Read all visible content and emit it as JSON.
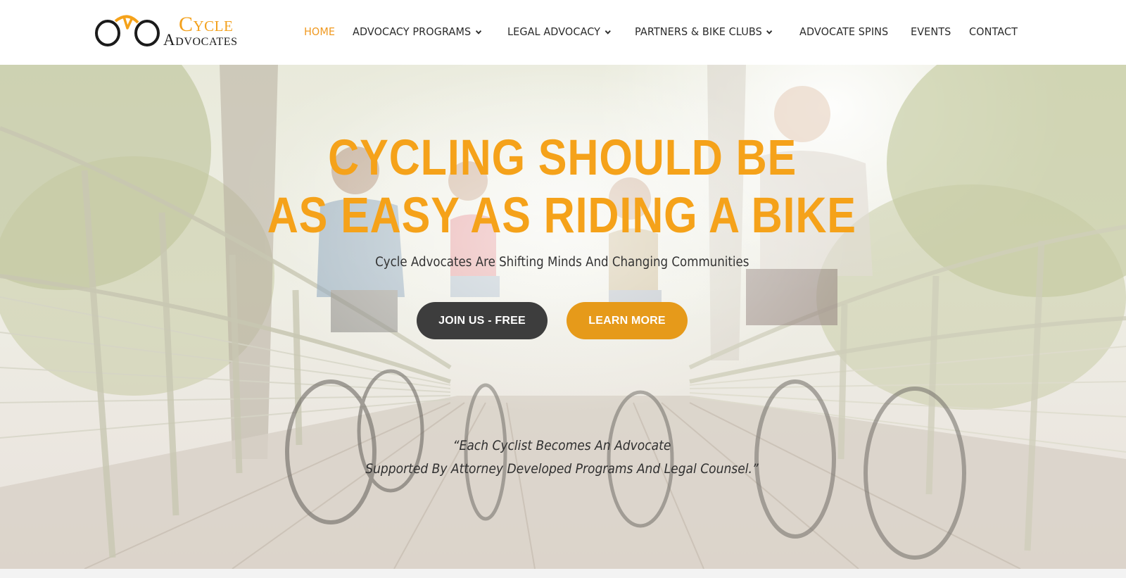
{
  "brand": {
    "line1": "Cycle",
    "line2": "Advocates",
    "accent_color": "#f5a21a",
    "dark_color": "#1b1b1b"
  },
  "nav": {
    "items": [
      {
        "label": "HOME",
        "active": true,
        "dropdown": false
      },
      {
        "label": "ADVOCACY PROGRAMS",
        "active": false,
        "dropdown": true
      },
      {
        "label": "LEGAL ADVOCACY",
        "active": false,
        "dropdown": true
      },
      {
        "label": "PARTNERS & BIKE CLUBS",
        "active": false,
        "dropdown": true
      },
      {
        "label": "ADVOCATE SPINS",
        "active": false,
        "dropdown": false
      },
      {
        "label": "EVENTS",
        "active": false,
        "dropdown": false
      },
      {
        "label": "CONTACT",
        "active": false,
        "dropdown": false
      }
    ],
    "active_color": "#f09a22",
    "dropdown_icon": "chevron-down-icon"
  },
  "hero": {
    "title_line1": "CYCLING SHOULD BE",
    "title_line2": "AS EASY AS RIDING A BIKE",
    "subtitle": "Cycle Advocates Are Shifting Minds And Changing Communities",
    "join_label": "JOIN US - FREE",
    "learn_label": "LEARN MORE",
    "quote_line1": "“Each Cyclist Becomes An Advocate",
    "quote_line2": "Supported By Attorney Developed Programs And Legal Counsel.”",
    "title_color": "#f5a21a",
    "join_color": "#3d3d3d",
    "learn_color": "#e69a1a",
    "background": "faded photo of four cyclists riding on a bridge"
  }
}
